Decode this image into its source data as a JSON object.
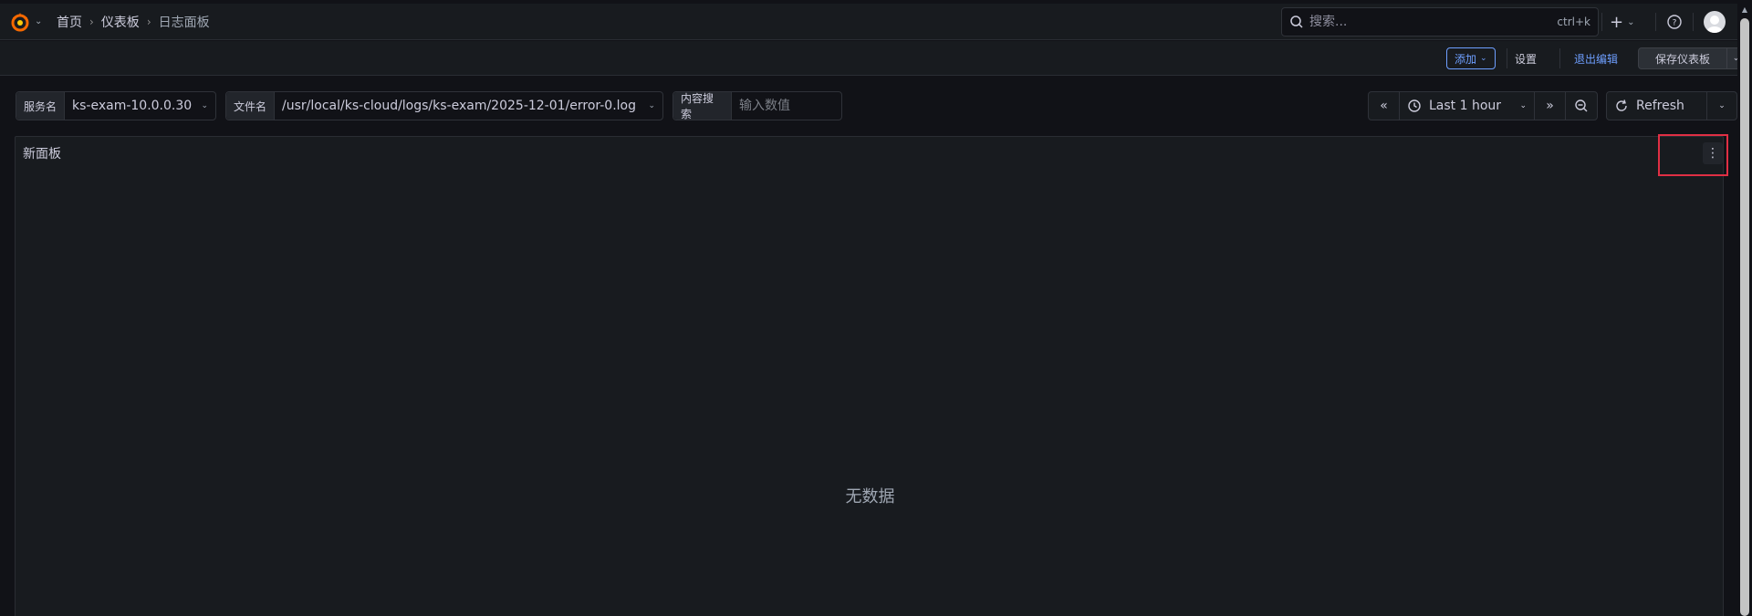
{
  "breadcrumb": [
    {
      "label": "首页"
    },
    {
      "label": "仪表板"
    },
    {
      "label": "日志面板"
    }
  ],
  "search": {
    "placeholder": "搜索...",
    "shortcut": "ctrl+k"
  },
  "toolbar": {
    "add_label": "添加",
    "settings_label": "设置",
    "exit_edit_label": "退出编辑",
    "save_label": "保存仪表板"
  },
  "variables": {
    "service": {
      "label": "服务名",
      "value": "ks-exam-10.0.0.30"
    },
    "file": {
      "label": "文件名",
      "value": "/usr/local/ks-cloud/logs/ks-exam/2025-12-01/error-0.log"
    },
    "content": {
      "label": "内容搜索",
      "placeholder": "输入数值"
    }
  },
  "time_picker": {
    "range_label": "Last 1 hour"
  },
  "refresh": {
    "label": "Refresh"
  },
  "panel": {
    "title": "新面板",
    "empty_text": "无数据"
  },
  "colors": {
    "accent": "#6e9fff",
    "highlight": "#e02f44",
    "logo": "#f46800"
  }
}
